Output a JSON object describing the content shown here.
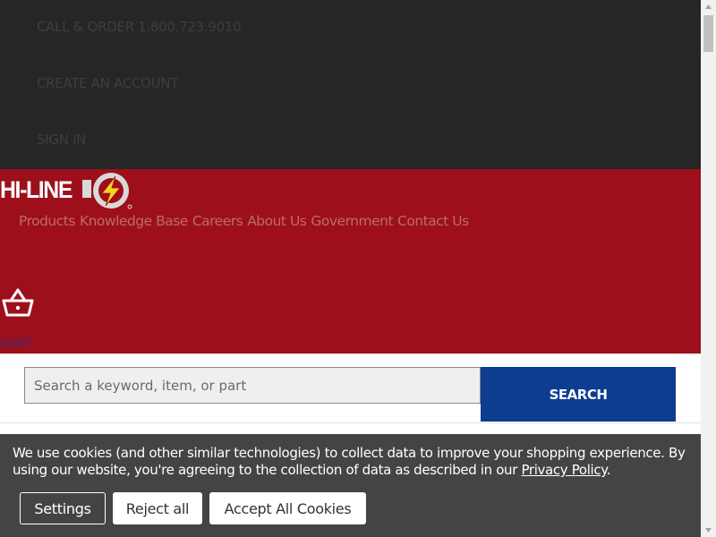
{
  "utility": {
    "call_order": "CALL & ORDER 1.800.723.9010",
    "create_account": "CREATE AN ACCOUNT",
    "sign_in": "SIGN IN"
  },
  "header": {
    "logo_text": "HI-LINE",
    "nav": [
      "Products",
      "Knowledge Base",
      "Careers",
      "About Us",
      "Government",
      "Contact Us"
    ],
    "cart_label": "CART"
  },
  "search": {
    "placeholder": "Search a keyword, item, or part",
    "button_label": "SEARCH"
  },
  "cookie": {
    "text": "We use cookies (and other similar technologies) to collect data to improve your shopping experience. By using our website, you're agreeing to the collection of data as described in our ",
    "link_text": "Privacy Policy",
    "end_punct": ".",
    "settings_label": "Settings",
    "reject_label": "Reject all",
    "accept_label": "Accept All Cookies"
  },
  "colors": {
    "utility_bg": "#262626",
    "header_red": "#9d101b",
    "search_blue": "#0d3d8f",
    "logo_bolt": "#f5d31f",
    "cookie_bg": "#444444"
  }
}
